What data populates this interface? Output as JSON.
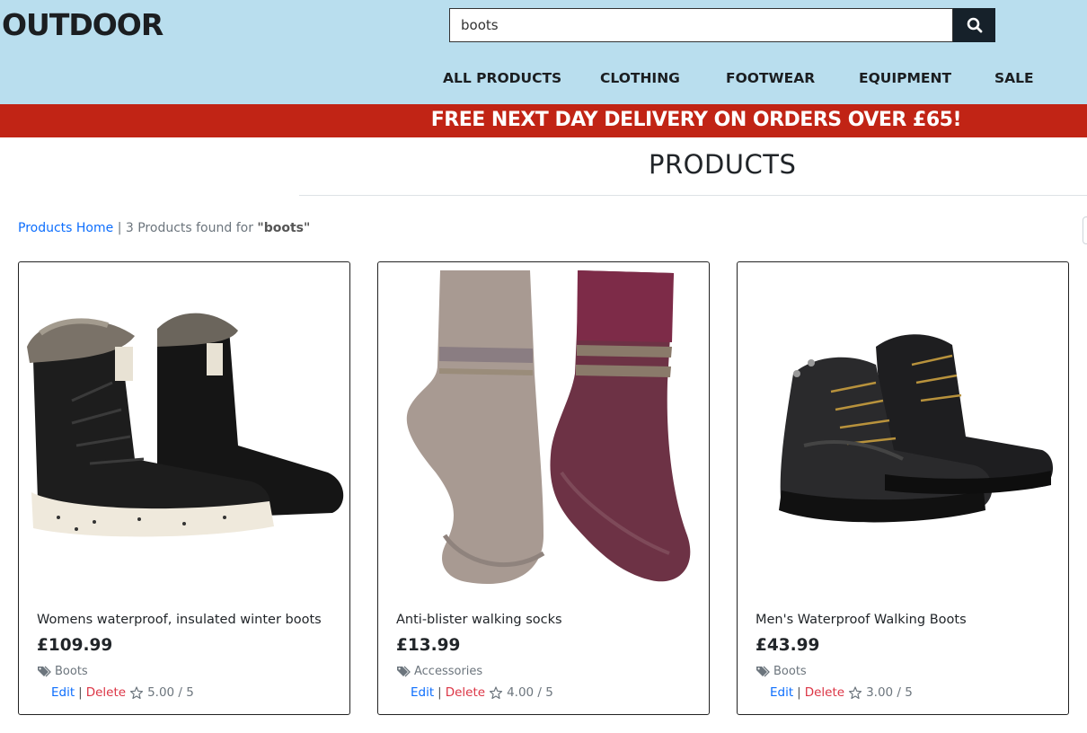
{
  "header": {
    "logo": "OUTDOOR",
    "search_value": "boots",
    "nav": [
      "ALL PRODUCTS",
      "CLOTHING",
      "FOOTWEAR",
      "EQUIPMENT",
      "SALE"
    ]
  },
  "banner": {
    "text": "FREE NEXT DAY DELIVERY ON ORDERS OVER £65!"
  },
  "page": {
    "title": "PRODUCTS",
    "breadcrumb_link": "Products Home",
    "breadcrumb_sep": "|",
    "results_prefix": "3 Products found for",
    "results_query": "\"boots\""
  },
  "products": [
    {
      "name": "Womens waterproof, insulated winter boots",
      "price": "£109.99",
      "category": "Boots",
      "edit": "Edit",
      "delete": "Delete",
      "rating": "5.00 / 5"
    },
    {
      "name": "Anti-blister walking socks",
      "price": "£13.99",
      "category": "Accessories",
      "edit": "Edit",
      "delete": "Delete",
      "rating": "4.00 / 5"
    },
    {
      "name": "Men's Waterproof Walking Boots",
      "price": "£43.99",
      "category": "Boots",
      "edit": "Edit",
      "delete": "Delete",
      "rating": "3.00 / 5"
    }
  ],
  "colors": {
    "header_bg": "#b9deee",
    "banner_bg": "#c12415",
    "link": "#0d6efd",
    "delete": "#dc3545"
  },
  "icons": {
    "search": "search-icon",
    "tag": "tag-icon",
    "star": "star-icon"
  }
}
